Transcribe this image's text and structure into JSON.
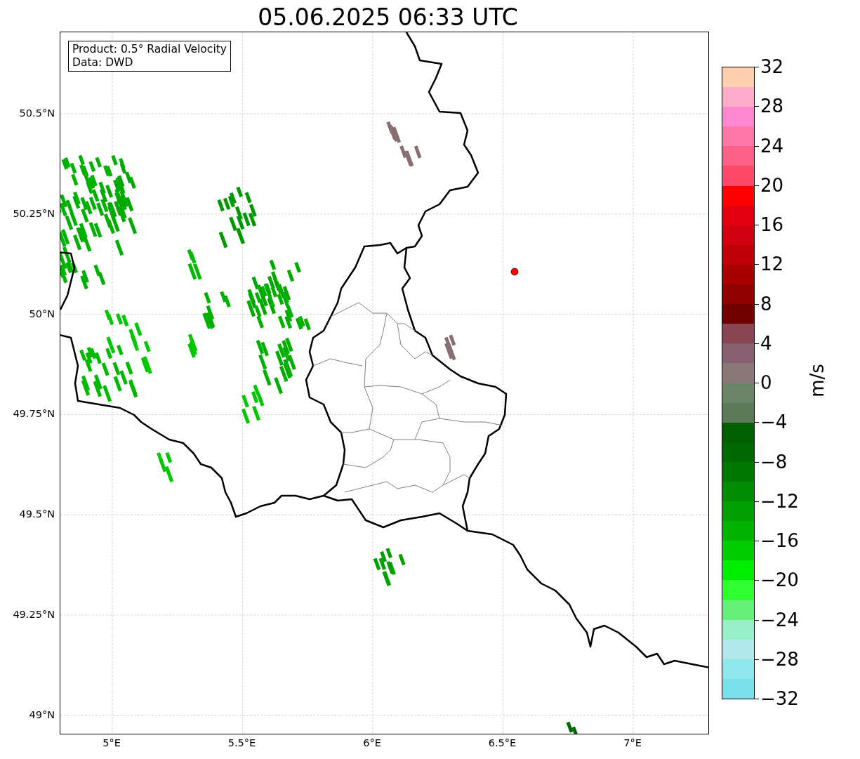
{
  "title": "05.06.2025 06:33 UTC",
  "info_box": {
    "lines": [
      "Product: 0.5° Radial Velocity",
      "Data: DWD"
    ]
  },
  "axes": {
    "x_ticks": [
      "5°E",
      "5.5°E",
      "6°E",
      "6.5°E",
      "7°E"
    ],
    "y_ticks": [
      "50.5°N",
      "50.25°N",
      "50°N",
      "49.75°N",
      "49.5°N",
      "49.25°N",
      "49°N"
    ]
  },
  "colorbar": {
    "label": "m/s",
    "ticks": [
      "32",
      "28",
      "24",
      "20",
      "16",
      "12",
      "8",
      "4",
      "0",
      "−4",
      "−8",
      "−12",
      "−16",
      "−20",
      "−24",
      "−28",
      "−32"
    ],
    "bands": [
      {
        "color": "#ffd0b0"
      },
      {
        "color": "#ffaac8"
      },
      {
        "color": "#ff88d0"
      },
      {
        "color": "#ff78a8"
      },
      {
        "color": "#ff6088"
      },
      {
        "color": "#ff4868"
      },
      {
        "color": "#ff0000"
      },
      {
        "color": "#e00010"
      },
      {
        "color": "#d00010"
      },
      {
        "color": "#c00008"
      },
      {
        "color": "#a80000"
      },
      {
        "color": "#900000"
      },
      {
        "color": "#700000"
      },
      {
        "color": "#884450"
      },
      {
        "color": "#886070"
      },
      {
        "color": "#887878"
      },
      {
        "color": "#6a8468"
      },
      {
        "color": "#5a7a58"
      },
      {
        "color": "#006000"
      },
      {
        "color": "#006800"
      },
      {
        "color": "#007800"
      },
      {
        "color": "#008c00"
      },
      {
        "color": "#00a000"
      },
      {
        "color": "#00b400"
      },
      {
        "color": "#00cc00"
      },
      {
        "color": "#00ee00"
      },
      {
        "color": "#30ff30"
      },
      {
        "color": "#66f07a"
      },
      {
        "color": "#98f0c8"
      },
      {
        "color": "#b0e8ec"
      },
      {
        "color": "#90e8ec"
      },
      {
        "color": "#78e0e8"
      }
    ]
  }
}
